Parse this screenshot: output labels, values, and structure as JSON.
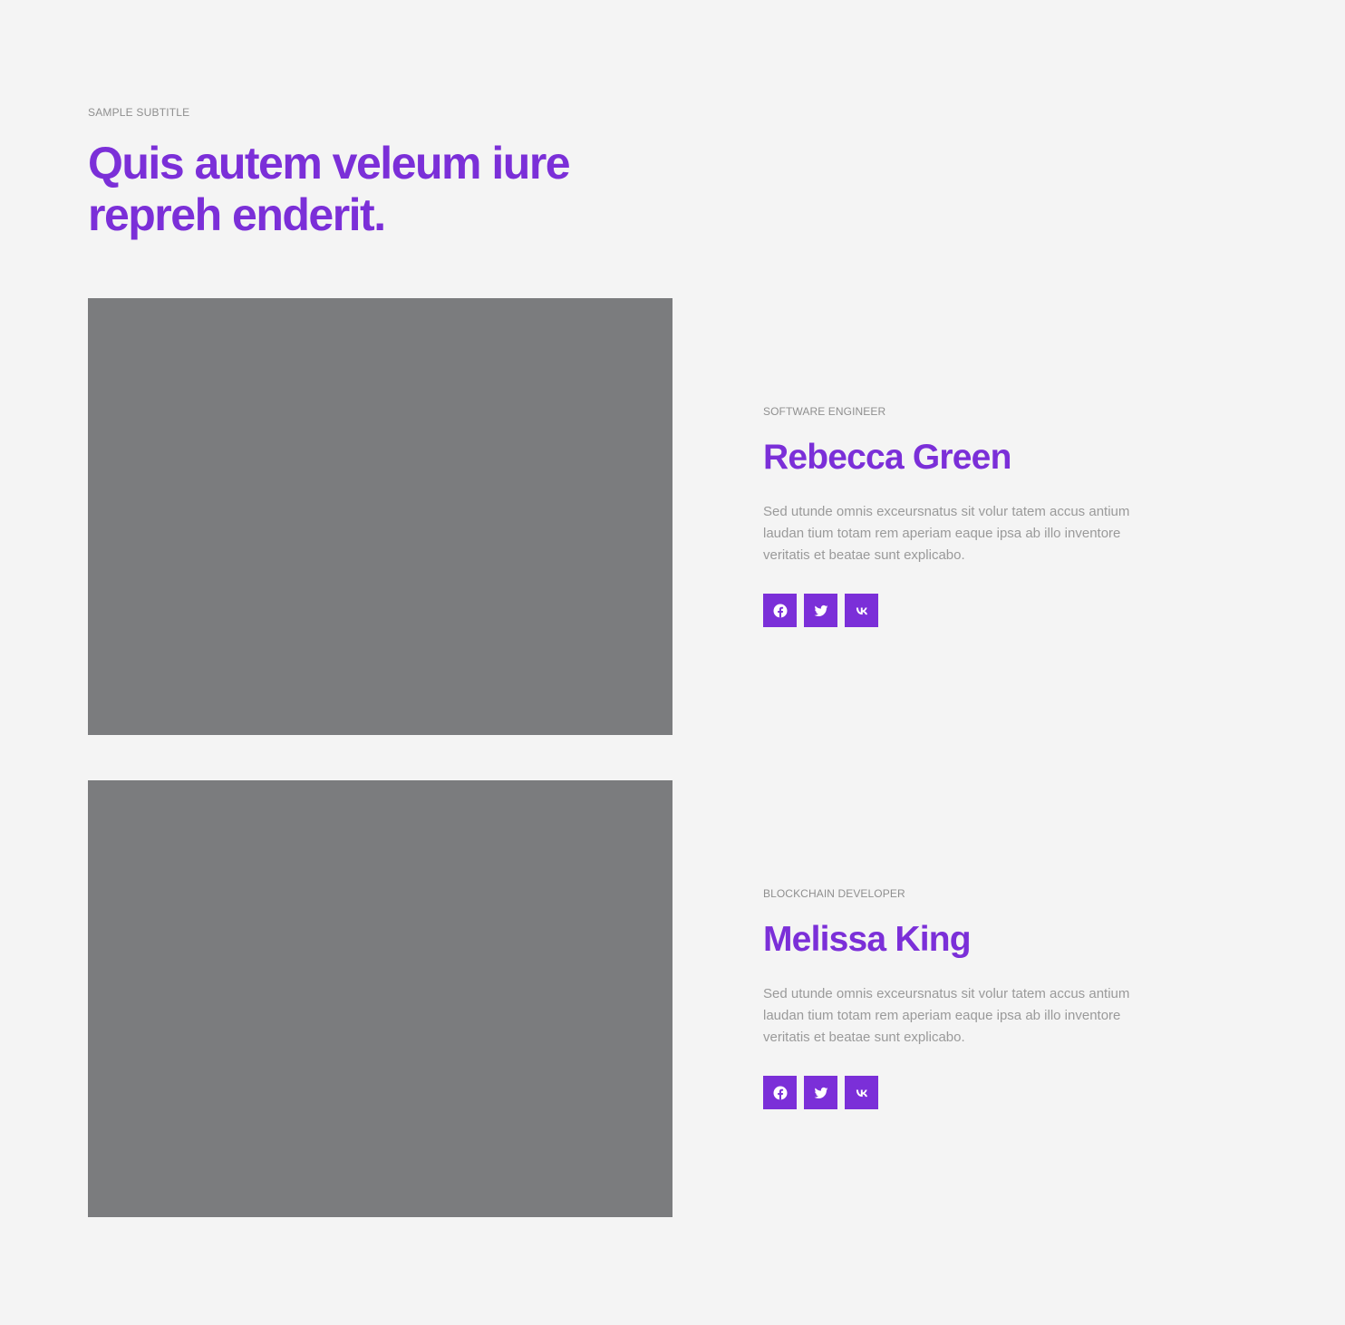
{
  "header": {
    "subtitle": "SAMPLE SUBTITLE",
    "title": "Quis autem veleum iure repreh enderit."
  },
  "team": [
    {
      "role": "SOFTWARE ENGINEER",
      "name": "Rebecca Green",
      "bio": "Sed utunde omnis exceursnatus sit volur tatem accus antium laudan tium totam rem aperiam eaque ipsa ab illo inventore veritatis et beatae sunt explicabo.",
      "socials": [
        "facebook-icon",
        "twitter-icon",
        "vk-icon"
      ]
    },
    {
      "role": "BLOCKCHAIN DEVELOPER",
      "name": "Melissa King",
      "bio": "Sed utunde omnis exceursnatus sit volur tatem accus antium laudan tium totam rem aperiam eaque ipsa ab illo inventore veritatis et beatae sunt explicabo.",
      "socials": [
        "facebook-icon",
        "twitter-icon",
        "vk-icon"
      ]
    }
  ],
  "colors": {
    "background": "#f4f4f4",
    "accent": "#7b2fd8",
    "photo_placeholder": "#7b7c7e",
    "muted_text": "#8f8f8f"
  }
}
